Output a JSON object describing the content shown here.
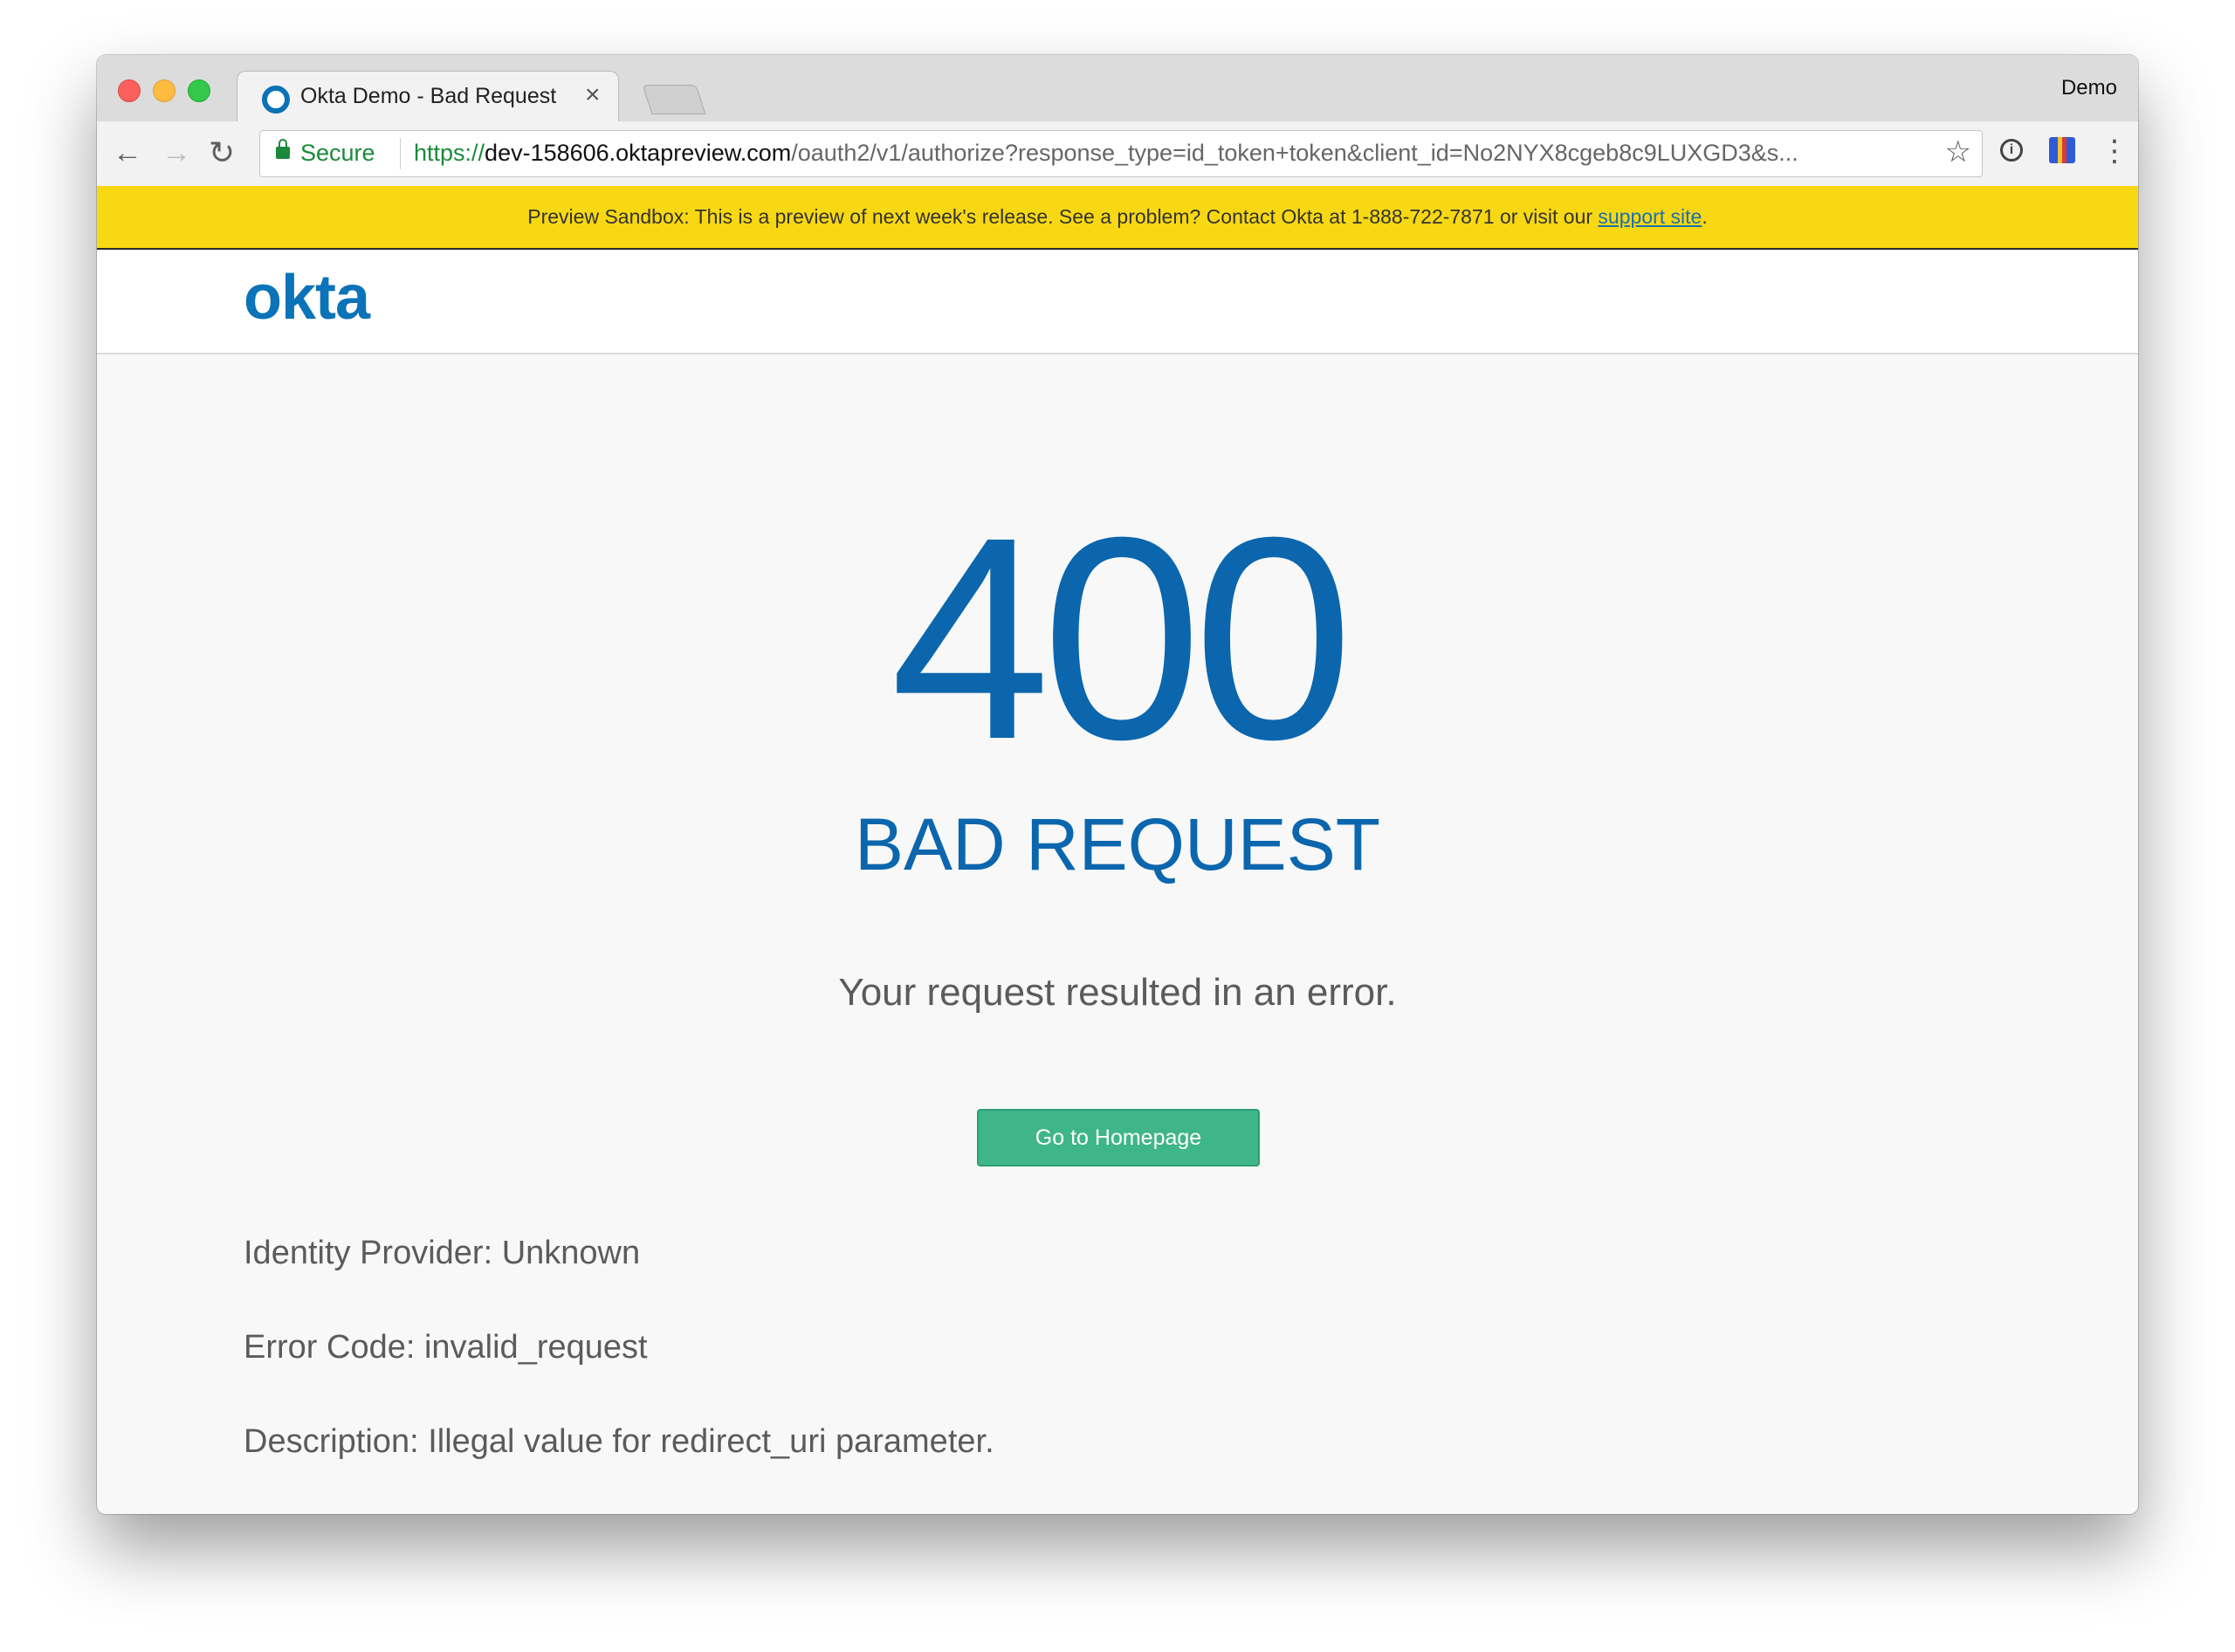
{
  "browser": {
    "tab_title": "Okta Demo - Bad Request",
    "tab_close": "×",
    "profile_name": "Demo",
    "secure_label": "Secure",
    "url_scheme": "https://",
    "url_host": "dev-158606.oktapreview.com",
    "url_path": "/oauth2/v1/authorize?response_type=id_token+token&client_id=No2NYX8cgeb8c9LUXGD3&s..."
  },
  "banner": {
    "text": "Preview Sandbox: This is a preview of next week's release. See a problem? Contact Okta at 1-888-722-7871 or visit our ",
    "link": "support site",
    "tail": "."
  },
  "header": {
    "logo_text": "okta"
  },
  "error": {
    "code": "400",
    "title": "BAD REQUEST",
    "message": "Your request resulted in an error.",
    "button_label": "Go to Homepage"
  },
  "details": [
    {
      "text": "Identity Provider: Unknown"
    },
    {
      "text": "Error Code: invalid_request"
    },
    {
      "text": "Description: Illegal value for redirect_uri parameter."
    }
  ],
  "colors": {
    "banner": "#f8d812",
    "brand_blue": "#0b66ad",
    "button_green": "#3fb58a"
  }
}
